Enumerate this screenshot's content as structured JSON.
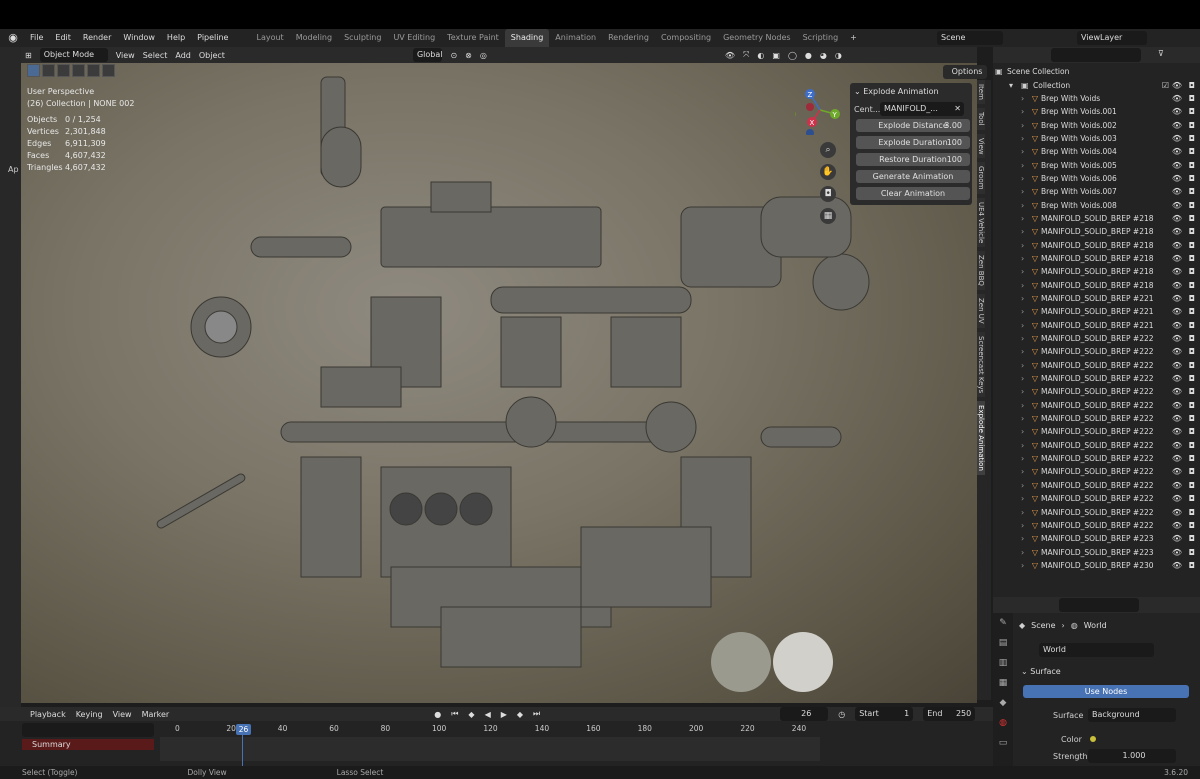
{
  "topbar": {
    "menu": [
      "File",
      "Edit",
      "Render",
      "Window",
      "Help",
      "Pipeline"
    ],
    "workspaces": [
      "Layout",
      "Modeling",
      "Sculpting",
      "UV Editing",
      "Texture Paint",
      "Shading",
      "Animation",
      "Rendering",
      "Compositing",
      "Geometry Nodes",
      "Scripting",
      "+"
    ],
    "active_workspace": "Shading",
    "scene": "Scene",
    "view_layer": "ViewLayer"
  },
  "viewport": {
    "mode": "Object Mode",
    "menus": [
      "View",
      "Select",
      "Add",
      "Object"
    ],
    "transform_orientation": "Global",
    "options_label": "Options",
    "overlay_title": "User Perspective",
    "overlay_subtitle": "(26) Collection | NONE 002",
    "stats": [
      {
        "k": "Objects",
        "v": "0 / 1,254"
      },
      {
        "k": "Vertices",
        "v": "2,301,848"
      },
      {
        "k": "Edges",
        "v": "6,911,309"
      },
      {
        "k": "Faces",
        "v": "4,607,432"
      },
      {
        "k": "Triangles",
        "v": "4,607,432"
      }
    ],
    "side_tabs": [
      "Item",
      "Tool",
      "View",
      "Groom",
      "UE4 Vehicle",
      "Zen BBQ",
      "Zen UV",
      "Screencast Keys",
      "Explode Animation"
    ],
    "active_side_tab": "Explode Animation",
    "gizmo": {
      "z": "Z",
      "y": "Y",
      "x": "X"
    },
    "left_edge_label": "Ap"
  },
  "explode_panel": {
    "title": "Explode Animation",
    "center_label": "Cent...",
    "center_value": "MANIFOLD_...",
    "distance_label": "Explode Distance",
    "distance_value": "3.00",
    "duration_label": "Explode Duration",
    "duration_value": "100",
    "restore_label": "Restore Duration",
    "restore_value": "100",
    "generate_label": "Generate Animation",
    "clear_label": "Clear Animation"
  },
  "outliner": {
    "root": "Scene Collection",
    "collection": "Collection",
    "items": [
      "Brep With Voids",
      "Brep With Voids.001",
      "Brep With Voids.002",
      "Brep With Voids.003",
      "Brep With Voids.004",
      "Brep With Voids.005",
      "Brep With Voids.006",
      "Brep With Voids.007",
      "Brep With Voids.008",
      "MANIFOLD_SOLID_BREP #218",
      "MANIFOLD_SOLID_BREP #218",
      "MANIFOLD_SOLID_BREP #218",
      "MANIFOLD_SOLID_BREP #218",
      "MANIFOLD_SOLID_BREP #218",
      "MANIFOLD_SOLID_BREP #218",
      "MANIFOLD_SOLID_BREP #221",
      "MANIFOLD_SOLID_BREP #221",
      "MANIFOLD_SOLID_BREP #221",
      "MANIFOLD_SOLID_BREP #222",
      "MANIFOLD_SOLID_BREP #222",
      "MANIFOLD_SOLID_BREP #222",
      "MANIFOLD_SOLID_BREP #222",
      "MANIFOLD_SOLID_BREP #222",
      "MANIFOLD_SOLID_BREP #222",
      "MANIFOLD_SOLID_BREP #222",
      "MANIFOLD_SOLID_BREP #222",
      "MANIFOLD_SOLID_BREP #222",
      "MANIFOLD_SOLID_BREP #222",
      "MANIFOLD_SOLID_BREP #222",
      "MANIFOLD_SOLID_BREP #222",
      "MANIFOLD_SOLID_BREP #222",
      "MANIFOLD_SOLID_BREP #222",
      "MANIFOLD_SOLID_BREP #222",
      "MANIFOLD_SOLID_BREP #223",
      "MANIFOLD_SOLID_BREP #223",
      "MANIFOLD_SOLID_BREP #230"
    ]
  },
  "properties": {
    "breadcrumb_scene": "Scene",
    "breadcrumb_world": "World",
    "world_name": "World",
    "section": "Surface",
    "use_nodes": "Use Nodes",
    "surface_label": "Surface",
    "surface_value": "Background",
    "color_label": "Color",
    "strength_label": "Strength",
    "strength_value": "1.000"
  },
  "timeline": {
    "menus": [
      "Playback",
      "Keying",
      "View",
      "Marker"
    ],
    "current_frame": "26",
    "start_label": "Start",
    "start_value": "1",
    "end_label": "End",
    "end_value": "250",
    "ticks": [
      "0",
      "20",
      "40",
      "60",
      "80",
      "100",
      "120",
      "140",
      "160",
      "180",
      "200",
      "220",
      "240"
    ],
    "playhead_label": "26",
    "summary": "Summary"
  },
  "statusbar": {
    "left": "Select (Toggle)",
    "middle": "Dolly View",
    "right": "Lasso Select",
    "version": "3.6.20"
  },
  "colors": {
    "accent": "#4772b3",
    "outliner_icon": "#e49a4a",
    "summary": "#5a1a1a"
  }
}
